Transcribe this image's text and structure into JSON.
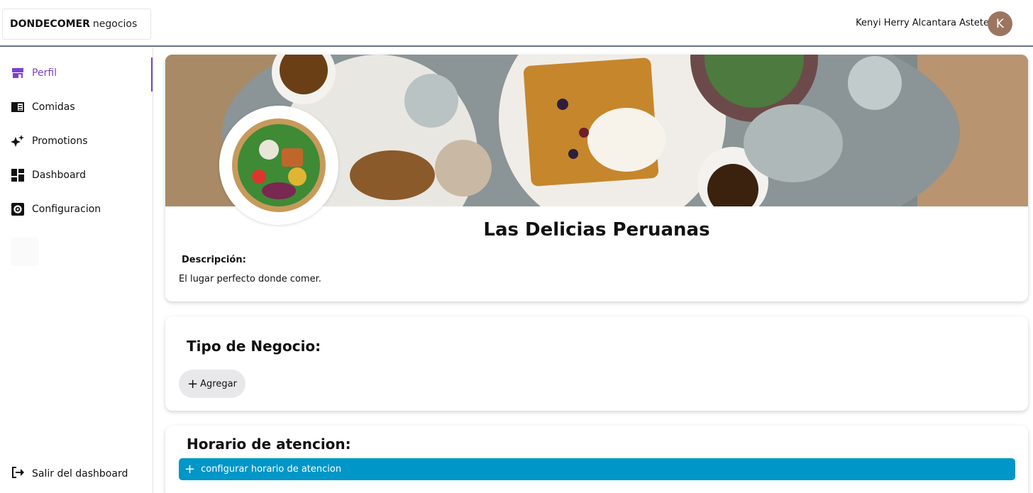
{
  "header": {
    "brand_bold": "DONDECOMER",
    "brand_light": "negocios",
    "user_name": "Kenyi Herry Alcantara Astete",
    "avatar_initial": "K"
  },
  "sidebar": {
    "items": [
      {
        "label": "Perfil",
        "icon": "store-icon",
        "active": true
      },
      {
        "label": "Comidas",
        "icon": "menu-book-icon",
        "active": false
      },
      {
        "label": "Promotions",
        "icon": "sparkle-icon",
        "active": false
      },
      {
        "label": "Dashboard",
        "icon": "dashboard-icon",
        "active": false
      },
      {
        "label": "Configuracion",
        "icon": "settings-icon",
        "active": false
      }
    ],
    "logout_label": "Salir del dashboard",
    "accent": "#7e3fd2"
  },
  "profile": {
    "name": "Las Delicias Peruanas",
    "description_label": "Descripción:",
    "description": "El lugar perfecto donde comer."
  },
  "business_type": {
    "title": "Tipo de Negocio:",
    "add_label": "Agregar"
  },
  "hours": {
    "title": "Horario de atencion:",
    "button_label": "configurar horario de atencion",
    "button_color": "#0096c7"
  }
}
